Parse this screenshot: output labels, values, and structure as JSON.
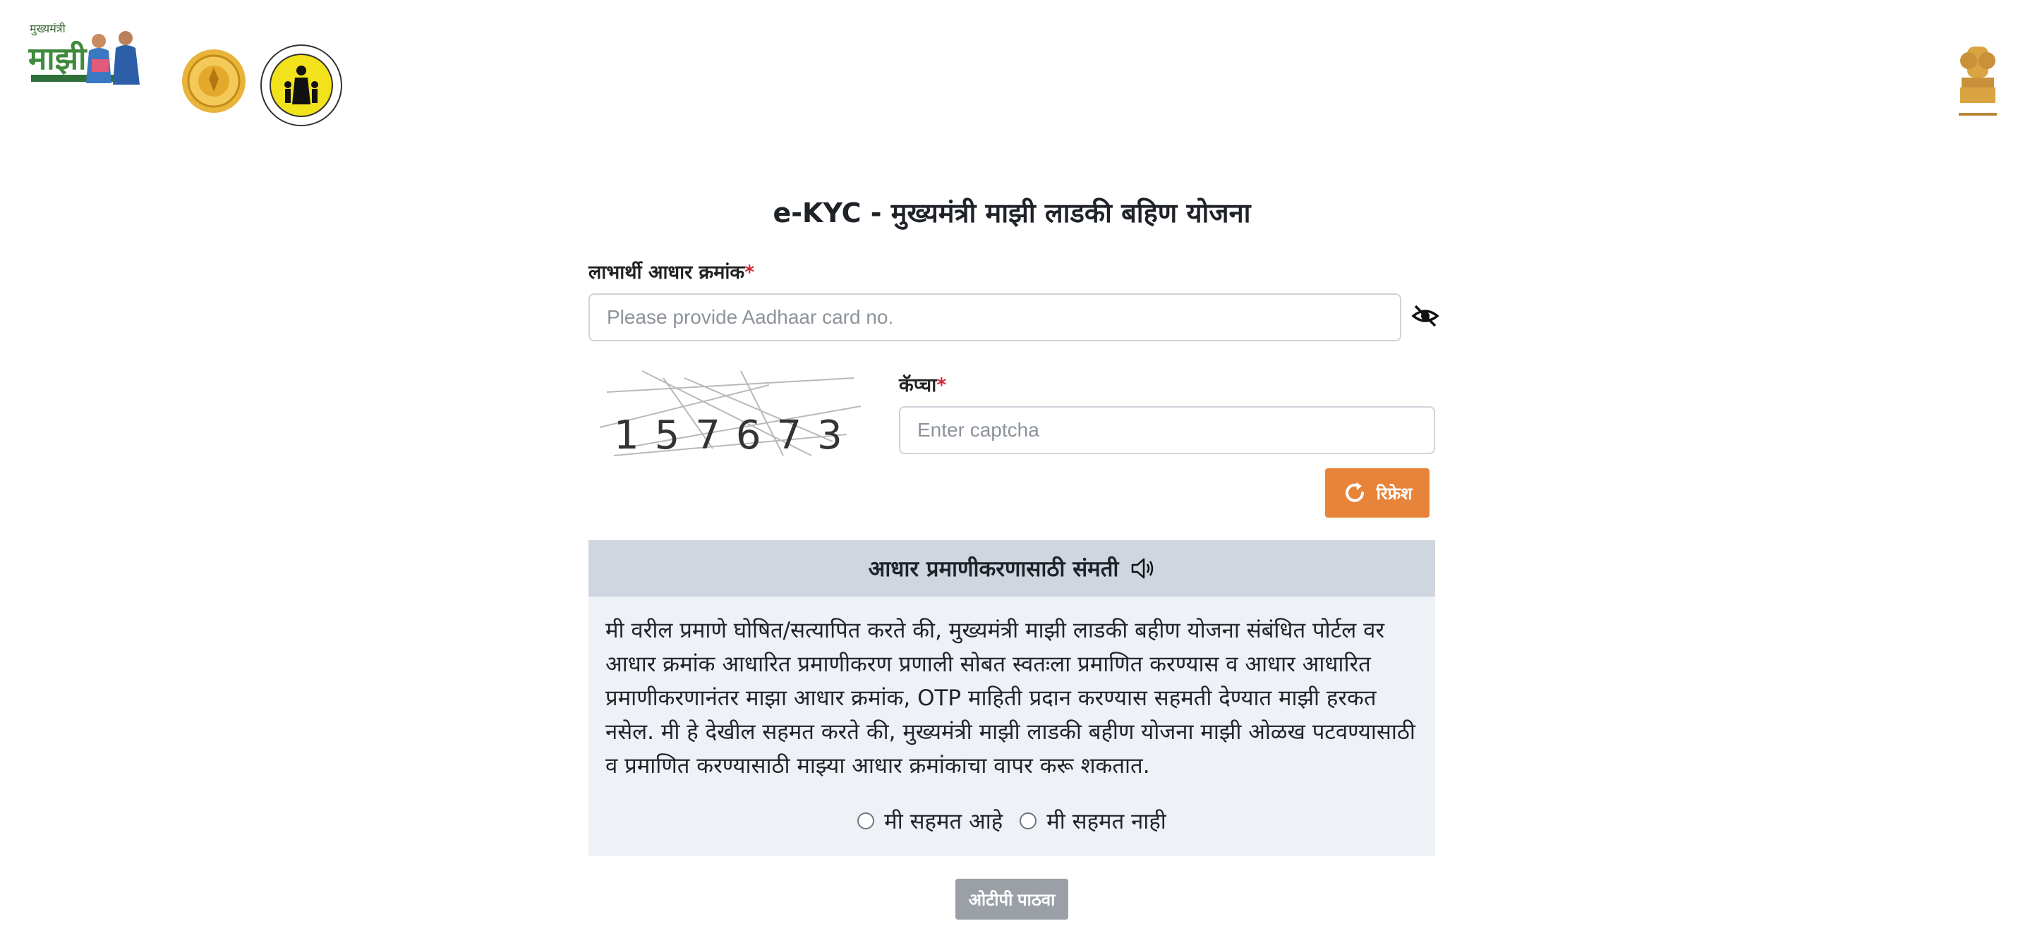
{
  "header": {
    "logo_caption": "मुख्यमंत्री",
    "logo_word": "माझी",
    "logos": [
      "mukhyamantri-majhi-ladki-bahin-logo",
      "maharashtra-seal-logo",
      "women-child-development-logo",
      "national-emblem-logo"
    ]
  },
  "form": {
    "title": "e-KYC - मुख्यमंत्री माझी लाडकी बहिण योजना",
    "aadhaar_label": "लाभार्थी आधार क्रमांक",
    "required_mark": "*",
    "aadhaar_placeholder": "Please provide Aadhaar card no.",
    "captcha_label": "कॅप्चा",
    "captcha_placeholder": "Enter captcha",
    "captcha_image_text": "157673",
    "refresh_label": "रिफ्रेश",
    "submit_label": "ओटीपी पाठवा"
  },
  "consent": {
    "header": "आधार प्रमाणीकरणासाठी संमती",
    "body": "मी वरील प्रमाणे घोषित/सत्यापित करते की, मुख्यमंत्री माझी लाडकी बहीण योजना संबंधित पोर्टल वर आधार क्रमांक आधारित प्रमाणीकरण प्रणाली सोबत स्वतःला प्रमाणित करण्यास व आधार आधारित प्रमाणीकरणानंतर माझा आधार क्रमांक, OTP माहिती प्रदान करण्यास सहमती देण्यात माझी हरकत नसेल. मी हे देखील सहमत करते की, मुख्यमंत्री माझी लाडकी बहीण योजना माझी ओळख पटवण्यासाठी व प्रमाणित करण्यासाठी माझ्या आधार क्रमांकाचा वापर करू शकतात.",
    "agree_label": "मी सहमत आहे",
    "disagree_label": "मी सहमत नाही"
  },
  "colors": {
    "refresh_button": "#e8833a",
    "otp_button": "#9aa0a6",
    "consent_header_bg": "#cfd6e0",
    "consent_body_bg": "#eef2f7",
    "required": "#d9263a"
  }
}
